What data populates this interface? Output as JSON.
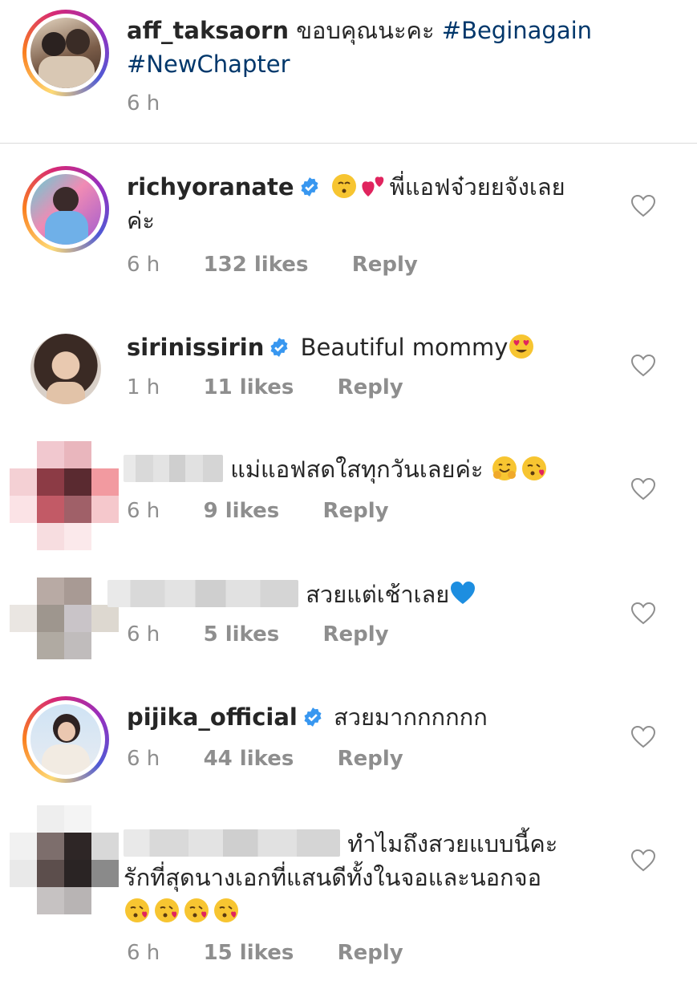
{
  "caption": {
    "username": "aff_taksaorn",
    "text": "ขอบคุณนะคะ",
    "hashtag1": "#Beginagain",
    "hashtag2": "#NewChapter",
    "time": "6 h"
  },
  "comments": [
    {
      "username": "richyoranate",
      "verified": true,
      "text_line1": "พี่แอฟจ๋วยยจังเลย",
      "text_line2": "ค่ะ",
      "time": "6 h",
      "likes": "132 likes",
      "reply": "Reply"
    },
    {
      "username": "sirinissirin",
      "verified": true,
      "text": "Beautiful mommy",
      "time": "1 h",
      "likes": "11 likes",
      "reply": "Reply"
    },
    {
      "username": "",
      "text": "แม่แอฟสดใสทุกวันเลยค่ะ",
      "time": "6 h",
      "likes": "9 likes",
      "reply": "Reply"
    },
    {
      "username": "",
      "text": "สวยแต่เช้าเลย",
      "time": "6 h",
      "likes": "5 likes",
      "reply": "Reply"
    },
    {
      "username": "pijika_official",
      "verified": true,
      "text": "สวยมากกกกกก",
      "time": "6 h",
      "likes": "44 likes",
      "reply": "Reply"
    },
    {
      "username": "",
      "text_line1": "ทำไมถึงสวยแบบนี้คะ",
      "text_line2": "รักที่สุดนางเอกที่แสนดีทั้งในจอและนอกจอ",
      "time": "6 h",
      "likes": "15 likes",
      "reply": "Reply"
    }
  ],
  "icons": {
    "verified": "verified-badge-icon",
    "like": "heart-outline-icon"
  },
  "colors": {
    "hashtag": "#00376b",
    "verified": "#3897f0",
    "meta": "#8e8e8e",
    "divider": "#dbdbdb"
  }
}
